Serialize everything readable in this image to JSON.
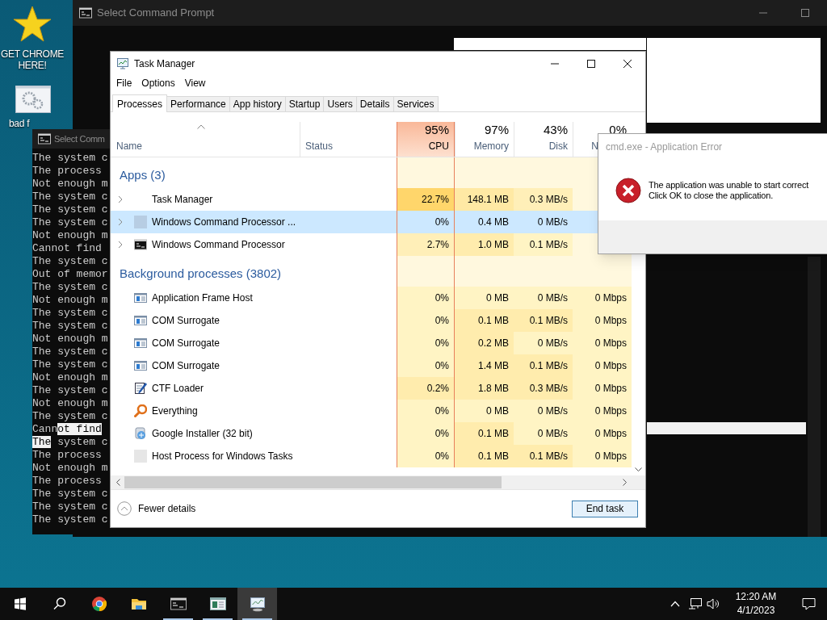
{
  "desktop": {
    "icons": [
      {
        "kind": "star",
        "label": "GET CHROME HERE!"
      },
      {
        "kind": "gears",
        "label": "bad f"
      }
    ]
  },
  "back_console": {
    "title": "Select Command Prompt"
  },
  "console": {
    "title": "Select Comm",
    "lines": [
      {
        "text": "The system c"
      },
      {
        "text": "The process"
      },
      {
        "text": "Not enough m"
      },
      {
        "text": "The system c"
      },
      {
        "text": "The system c"
      },
      {
        "text": "The system c"
      },
      {
        "text": "Not enough m"
      },
      {
        "text": "Cannot find"
      },
      {
        "text": "The system c"
      },
      {
        "text": "Out of memor"
      },
      {
        "text": "The system c"
      },
      {
        "text": "Not enough m"
      },
      {
        "text": "The system c"
      },
      {
        "text": "The system c"
      },
      {
        "text": "Not enough m"
      },
      {
        "text": "The system c"
      },
      {
        "text": "The system c"
      },
      {
        "text": "Not enough m"
      },
      {
        "text": "The system c"
      },
      {
        "text": "Not enough m"
      },
      {
        "text": "The system c"
      },
      {
        "parts": [
          {
            "text": "Cann",
            "selected": false
          },
          {
            "text": "ot find",
            "selected": true
          }
        ]
      },
      {
        "parts": [
          {
            "text": "The",
            "selected": true
          },
          {
            "text": " system c",
            "selected": false
          }
        ]
      },
      {
        "text": "The process"
      },
      {
        "text": "Not enough m"
      },
      {
        "text": "The process"
      },
      {
        "text": "The system c"
      },
      {
        "text": "The system c"
      },
      {
        "text": "The system c"
      }
    ]
  },
  "task_manager": {
    "title": "Task Manager",
    "menu": [
      "File",
      "Options",
      "View"
    ],
    "tabs": [
      {
        "label": "Processes",
        "selected": true
      },
      {
        "label": "Performance",
        "selected": false
      },
      {
        "label": "App history",
        "selected": false
      },
      {
        "label": "Startup",
        "selected": false
      },
      {
        "label": "Users",
        "selected": false
      },
      {
        "label": "Details",
        "selected": false
      },
      {
        "label": "Services",
        "selected": false
      }
    ],
    "name_column": {
      "label": "Name",
      "sorted": true
    },
    "status_column": {
      "label": "Status"
    },
    "resource_columns": [
      {
        "usage": "95%",
        "label": "CPU",
        "highlighted": true
      },
      {
        "usage": "97%",
        "label": "Memory",
        "highlighted": false
      },
      {
        "usage": "43%",
        "label": "Disk",
        "highlighted": false
      },
      {
        "usage": "0%",
        "label": "N",
        "highlighted": false
      }
    ],
    "groups": [
      {
        "label": "Apps (3)",
        "rows": [
          {
            "kind": "blank",
            "name": "Task Manager",
            "expandable": true,
            "selected": false,
            "cells": [
              {
                "text": "22.7%",
                "color": "#ffd66b"
              },
              {
                "text": "148.1 MB",
                "color": "#ffe9a4"
              },
              {
                "text": "0.3 MB/s",
                "color": "#ffefb8"
              }
            ]
          },
          {
            "kind": "square",
            "name": "Windows Command Processor ...",
            "expandable": true,
            "selected": true,
            "cells": [
              {
                "text": "0%"
              },
              {
                "text": "0.4 MB"
              },
              {
                "text": "0 MB/s"
              }
            ]
          },
          {
            "kind": "console",
            "name": "Windows Command Processor",
            "expandable": true,
            "selected": false,
            "cells": [
              {
                "text": "2.7%",
                "color": "#ffefb8"
              },
              {
                "text": "1.0 MB",
                "color": "#ffecad"
              },
              {
                "text": "0.1 MB/s",
                "color": "#fff4c4"
              }
            ]
          }
        ]
      },
      {
        "label": "Background processes (3802)",
        "rows": [
          {
            "kind": "window",
            "name": "Application Frame Host",
            "expandable": false,
            "selected": false,
            "cells": [
              {
                "text": "0%",
                "color": "#fff4c4"
              },
              {
                "text": "0 MB",
                "color": "#fff4c4"
              },
              {
                "text": "0 MB/s",
                "color": "#fff4c4"
              },
              {
                "text": "0 Mbps",
                "color": "#fff4c4"
              }
            ]
          },
          {
            "kind": "window",
            "name": "COM Surrogate",
            "expandable": false,
            "selected": false,
            "cells": [
              {
                "text": "0%",
                "color": "#fff4c4"
              },
              {
                "text": "0.1 MB",
                "color": "#ffecad"
              },
              {
                "text": "0.1 MB/s",
                "color": "#ffecad"
              },
              {
                "text": "0 Mbps",
                "color": "#fff4c4"
              }
            ]
          },
          {
            "kind": "window",
            "name": "COM Surrogate",
            "expandable": false,
            "selected": false,
            "cells": [
              {
                "text": "0%",
                "color": "#fff4c4"
              },
              {
                "text": "0.2 MB",
                "color": "#ffecad"
              },
              {
                "text": "0 MB/s",
                "color": "#fff4c4"
              },
              {
                "text": "0 Mbps",
                "color": "#fff4c4"
              }
            ]
          },
          {
            "kind": "window",
            "name": "COM Surrogate",
            "expandable": false,
            "selected": false,
            "cells": [
              {
                "text": "0%",
                "color": "#fff4c4"
              },
              {
                "text": "1.4 MB",
                "color": "#ffecad"
              },
              {
                "text": "0.1 MB/s",
                "color": "#ffecad"
              },
              {
                "text": "0 Mbps",
                "color": "#fff4c4"
              }
            ]
          },
          {
            "kind": "notepad",
            "name": "CTF Loader",
            "expandable": false,
            "selected": false,
            "cells": [
              {
                "text": "0.2%",
                "color": "#ffecad"
              },
              {
                "text": "1.8 MB",
                "color": "#ffecad"
              },
              {
                "text": "0.3 MB/s",
                "color": "#ffecad"
              },
              {
                "text": "0 Mbps",
                "color": "#fff4c4"
              }
            ]
          },
          {
            "kind": "magnifier",
            "name": "Everything",
            "expandable": false,
            "selected": false,
            "cells": [
              {
                "text": "0%",
                "color": "#fff4c4"
              },
              {
                "text": "0 MB",
                "color": "#fff4c4"
              },
              {
                "text": "0 MB/s",
                "color": "#fff4c4"
              },
              {
                "text": "0 Mbps",
                "color": "#fff4c4"
              }
            ]
          },
          {
            "kind": "installer",
            "name": "Google Installer (32 bit)",
            "expandable": false,
            "selected": false,
            "cells": [
              {
                "text": "0%",
                "color": "#fff4c4"
              },
              {
                "text": "0.1 MB",
                "color": "#ffecad"
              },
              {
                "text": "0 MB/s",
                "color": "#fff4c4"
              },
              {
                "text": "0 Mbps",
                "color": "#fff4c4"
              }
            ]
          },
          {
            "kind": "plain",
            "name": "Host Process for Windows Tasks",
            "expandable": false,
            "selected": false,
            "cells": [
              {
                "text": "0%",
                "color": "#fff4c4"
              },
              {
                "text": "0.1 MB",
                "color": "#ffecad"
              },
              {
                "text": "0.1 MB/s",
                "color": "#ffecad"
              },
              {
                "text": "0 Mbps",
                "color": "#fff4c4"
              }
            ]
          }
        ]
      }
    ],
    "fewer_details": "Fewer details",
    "end_task": "End task"
  },
  "error_dialog": {
    "title": "cmd.exe - Application Error",
    "message": "The application was unable to start correct\nClick OK to close the application."
  },
  "taskbar": {
    "items": [
      {
        "kind": "start",
        "running": false,
        "active": false
      },
      {
        "kind": "search",
        "running": false,
        "active": false
      },
      {
        "kind": "chrome",
        "running": false,
        "active": false
      },
      {
        "kind": "folder",
        "running": false,
        "active": false
      },
      {
        "kind": "console",
        "running": true,
        "active": false
      },
      {
        "kind": "window",
        "running": true,
        "active": false
      },
      {
        "kind": "monitor",
        "running": true,
        "active": true
      }
    ],
    "time": "12:20 AM",
    "date": "4/1/2023"
  }
}
